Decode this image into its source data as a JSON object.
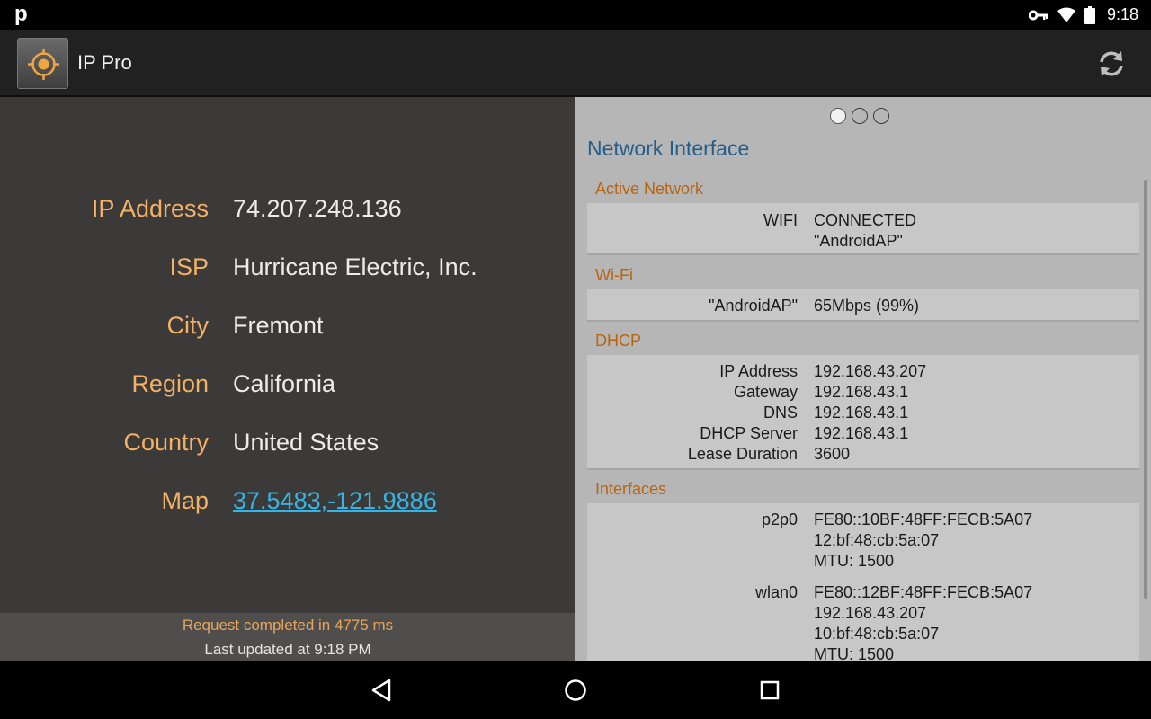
{
  "status_bar": {
    "notification_letter": "p",
    "time": "9:18"
  },
  "app": {
    "title": "IP Pro"
  },
  "ip_info": [
    {
      "label": "IP Address",
      "value": "74.207.248.136"
    },
    {
      "label": "ISP",
      "value": "Hurricane Electric, Inc."
    },
    {
      "label": "City",
      "value": "Fremont"
    },
    {
      "label": "Region",
      "value": "California"
    },
    {
      "label": "Country",
      "value": "United States"
    },
    {
      "label": "Map",
      "value": "37.5483,-121.9886"
    }
  ],
  "footer": {
    "request_status": "Request completed in 4775 ms",
    "last_updated": "Last updated at 9:18 PM"
  },
  "network": {
    "title": "Network Interface",
    "pager": {
      "pages": 3,
      "active": 0
    },
    "active_network": {
      "header": "Active Network",
      "key": "WIFI",
      "value_line1": "CONNECTED",
      "value_line2": "\"AndroidAP\""
    },
    "wifi": {
      "header": "Wi-Fi",
      "key": "\"AndroidAP\"",
      "value": "65Mbps (99%)"
    },
    "dhcp": {
      "header": "DHCP",
      "rows": [
        {
          "key": "IP Address",
          "value": "192.168.43.207"
        },
        {
          "key": "Gateway",
          "value": "192.168.43.1"
        },
        {
          "key": "DNS",
          "value": "192.168.43.1"
        },
        {
          "key": "DHCP Server",
          "value": "192.168.43.1"
        },
        {
          "key": "Lease Duration",
          "value": "3600"
        }
      ]
    },
    "interfaces": {
      "header": "Interfaces",
      "items": [
        {
          "name": "p2p0",
          "ipv6": "FE80::10BF:48FF:FECB:5A07",
          "mac": "12:bf:48:cb:5a:07",
          "mtu": "MTU: 1500"
        },
        {
          "name": "wlan0",
          "ipv6": "FE80::12BF:48FF:FECB:5A07",
          "ipv4": "192.168.43.207",
          "mac": "10:bf:48:cb:5a:07",
          "mtu": "MTU: 1500"
        }
      ]
    }
  },
  "colors": {
    "label_orange": "#f4b165",
    "link_blue": "#33b5e5",
    "section_blue": "#255e8a",
    "group_header_orange": "#b8650f"
  },
  "icons": {
    "app": "crosshair-icon",
    "refresh": "refresh-icon",
    "back": "back-icon",
    "home": "home-icon",
    "recents": "recents-icon"
  }
}
